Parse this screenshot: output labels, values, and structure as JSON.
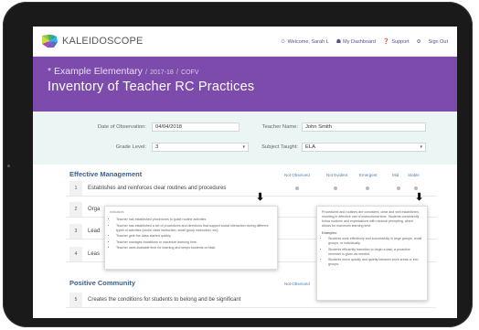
{
  "nav": {
    "brand": "KALEIDOSCOPE",
    "welcome": "Welcome, Sarah L",
    "dashboard": "My Dashboard",
    "support": "Support",
    "signout": "Sign Out"
  },
  "header": {
    "school": "* Example Elementary",
    "year": "2017-18",
    "code": "COFV",
    "title": "Inventory of Teacher RC Practices"
  },
  "form": {
    "date_label": "Date of Observation:",
    "date_value": "04/04/2018",
    "teacher_label": "Teacher Name:",
    "teacher_value": "John Smith",
    "grade_label": "Grade Level:",
    "grade_value": "3",
    "subject_label": "Subject Taught:",
    "subject_value": "ELA"
  },
  "table": {
    "section1": "Effective Management",
    "section2": "Positive Community",
    "columns": [
      "Not Observed",
      "Not Evident",
      "Emergent",
      "Mid",
      "Stable"
    ],
    "rows": [
      {
        "num": "1",
        "text": "Establishes and reinforces clear routines and procedures"
      },
      {
        "num": "2",
        "text": "Orga"
      },
      {
        "num": "3",
        "text": "Lead"
      },
      {
        "num": "4",
        "text": "Leas"
      },
      {
        "num": "5",
        "text": "Creates the conditions for students to belong and be significant"
      }
    ]
  },
  "popup_left": {
    "title": "Indicators",
    "items": [
      "Teacher has established procedures to guide routine activities.",
      "Teacher has established a set of procedures and directions that support social interaction during different types of activities (whole class instruction, small group instruction, etc).",
      "Teacher gets the class started quickly.",
      "Teacher manages transitions to maximize learning time.",
      "Teacher uses available time for learning and keeps students on task."
    ]
  },
  "popup_right": {
    "intro": "Procedures and routines are consistent, clear and well established, resulting in effective use of instructional time. Students consistently follow routines and expectations with minimal prompting, which allows for maximum learning time.",
    "examples_label": "Examples:",
    "items": [
      "Students work effectively and successfully in large groups, small groups, or individually.",
      "Students efficiently transition to begin a task; a proactive reminder is given as needed.",
      "Students move quickly and quietly between work areas or into groups."
    ]
  },
  "colors": {
    "header": "#7c4bab",
    "form_bg": "#eaf5f4",
    "section_text": "#3d5f8c"
  }
}
